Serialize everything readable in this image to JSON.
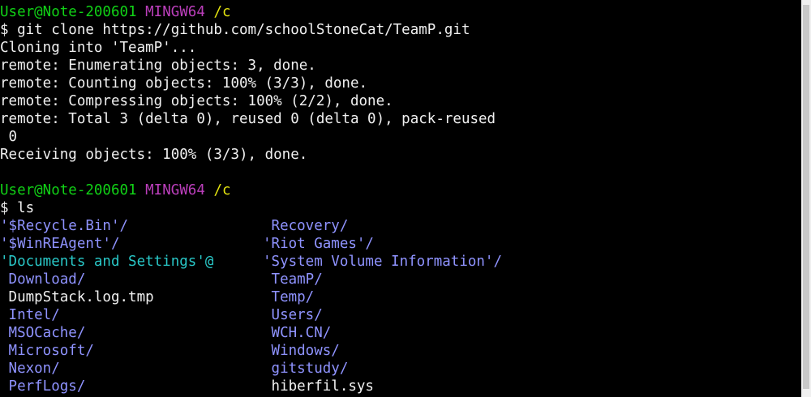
{
  "prompt1": {
    "user_host": "User@Note-200601",
    "shell": "MINGW64",
    "cwd": "/c"
  },
  "clone": {
    "command": "$ git clone https://github.com/schoolStoneCat/TeamP.git",
    "output": [
      "Cloning into 'TeamP'...",
      "remote: Enumerating objects: 3, done.",
      "remote: Counting objects: 100% (3/3), done.",
      "remote: Compressing objects: 100% (2/2), done.",
      "remote: Total 3 (delta 0), reused 0 (delta 0), pack-reused",
      " 0",
      "Receiving objects: 100% (3/3), done."
    ]
  },
  "prompt2": {
    "user_host": "User@Note-200601",
    "shell": "MINGW64",
    "cwd": "/c"
  },
  "ls": {
    "command": "$ ls",
    "left": [
      {
        "text": "'$Recycle.Bin'/",
        "kind": "dir"
      },
      {
        "text": "'$WinREAgent'/",
        "kind": "dir"
      },
      {
        "text": "'Documents and Settings'@",
        "kind": "link"
      },
      {
        "text": " Download/",
        "kind": "dir"
      },
      {
        "text": " DumpStack.log.tmp",
        "kind": "file"
      },
      {
        "text": " Intel/",
        "kind": "dir"
      },
      {
        "text": " MSOCache/",
        "kind": "dir"
      },
      {
        "text": " Microsoft/",
        "kind": "dir"
      },
      {
        "text": " Nexon/",
        "kind": "dir"
      },
      {
        "text": " PerfLogs/",
        "kind": "dir"
      }
    ],
    "right": [
      {
        "text": " Recovery/",
        "kind": "dir"
      },
      {
        "text": "'Riot Games'/",
        "kind": "dir"
      },
      {
        "text": "'System Volume Information'/",
        "kind": "dir"
      },
      {
        "text": " TeamP/",
        "kind": "dir"
      },
      {
        "text": " Temp/",
        "kind": "dir"
      },
      {
        "text": " Users/",
        "kind": "dir"
      },
      {
        "text": " WCH.CN/",
        "kind": "dir"
      },
      {
        "text": " Windows/",
        "kind": "dir"
      },
      {
        "text": " gitstudy/",
        "kind": "dir"
      },
      {
        "text": " hiberfil.sys",
        "kind": "file"
      }
    ]
  },
  "colors": {
    "background": "#000000",
    "text": "#f0f0f0",
    "user_host": "#11d116",
    "shell": "#bc3fbc",
    "cwd": "#e5e510",
    "directory": "#8f93ff",
    "symlink": "#29c7c7"
  }
}
